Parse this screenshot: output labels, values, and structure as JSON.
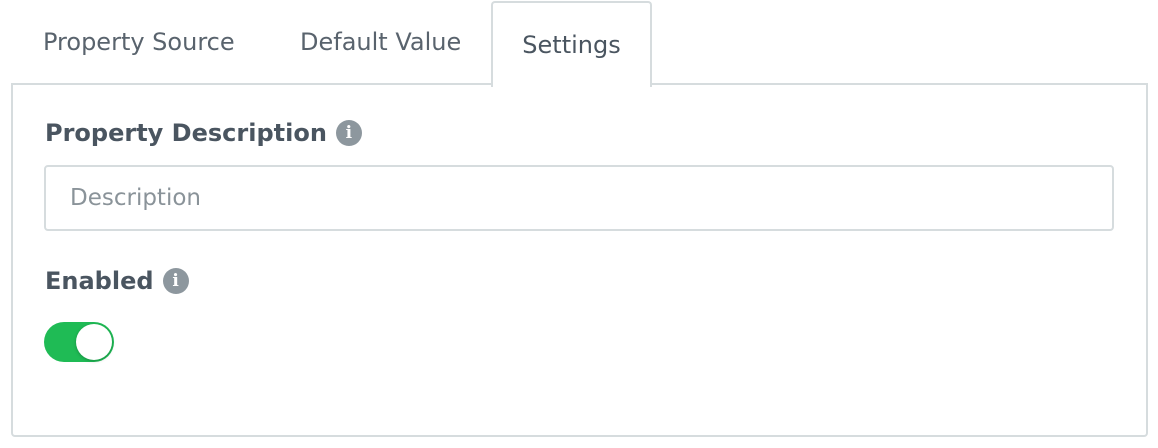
{
  "tabs": [
    {
      "label": "Property Source",
      "active": false
    },
    {
      "label": "Default Value",
      "active": false
    },
    {
      "label": "Settings",
      "active": true
    }
  ],
  "settings": {
    "description": {
      "label": "Property Description",
      "info_icon": "info-icon",
      "value": "",
      "placeholder": "Description"
    },
    "enabled": {
      "label": "Enabled",
      "info_icon": "info-icon",
      "state": true,
      "color_on": "#1fbb55"
    }
  }
}
